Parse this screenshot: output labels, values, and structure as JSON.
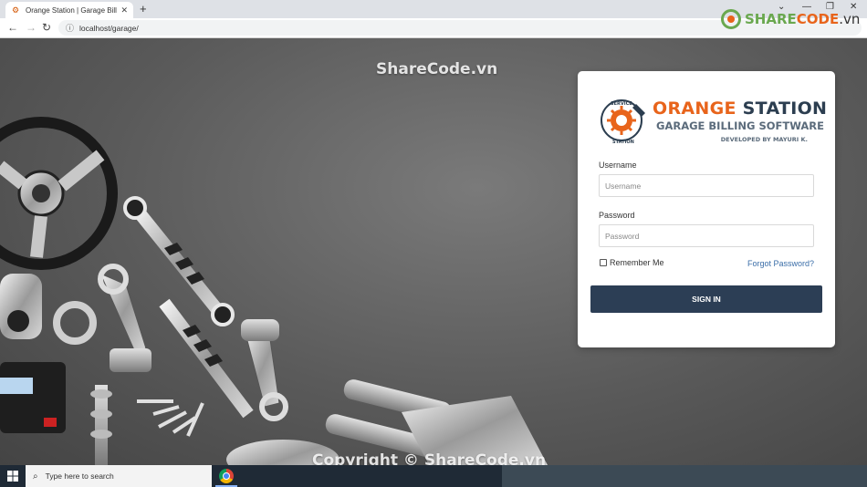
{
  "browser": {
    "tab_title": "Orange Station | Garage Billing S",
    "url": "localhost/garage/",
    "new_tab": "+",
    "close": "✕"
  },
  "watermark": {
    "brand_share": "SHARE",
    "brand_code": "CODE",
    "brand_tld": ".vn",
    "top_text": "ShareCode.vn",
    "bottom_text": "Copyright © ShareCode.vn"
  },
  "logo": {
    "title_orange": "ORANGE",
    "title_dark": " STATION",
    "subtitle": "GARAGE BILLING SOFTWARE",
    "developer": "DEVELOPED BY MAYURI K.",
    "badge_top": "SERVICE",
    "badge_bottom": "STATION"
  },
  "form": {
    "username_label": "Username",
    "username_placeholder": "Username",
    "password_label": "Password",
    "password_placeholder": "Password",
    "remember_label": "Remember Me",
    "forgot_label": "Forgot Password?",
    "signin_label": "SIGN IN"
  },
  "taskbar": {
    "search_placeholder": "Type here to search"
  },
  "colors": {
    "accent_orange": "#e8641b",
    "button_navy": "#2c3e55",
    "link_blue": "#3b6ea8"
  }
}
